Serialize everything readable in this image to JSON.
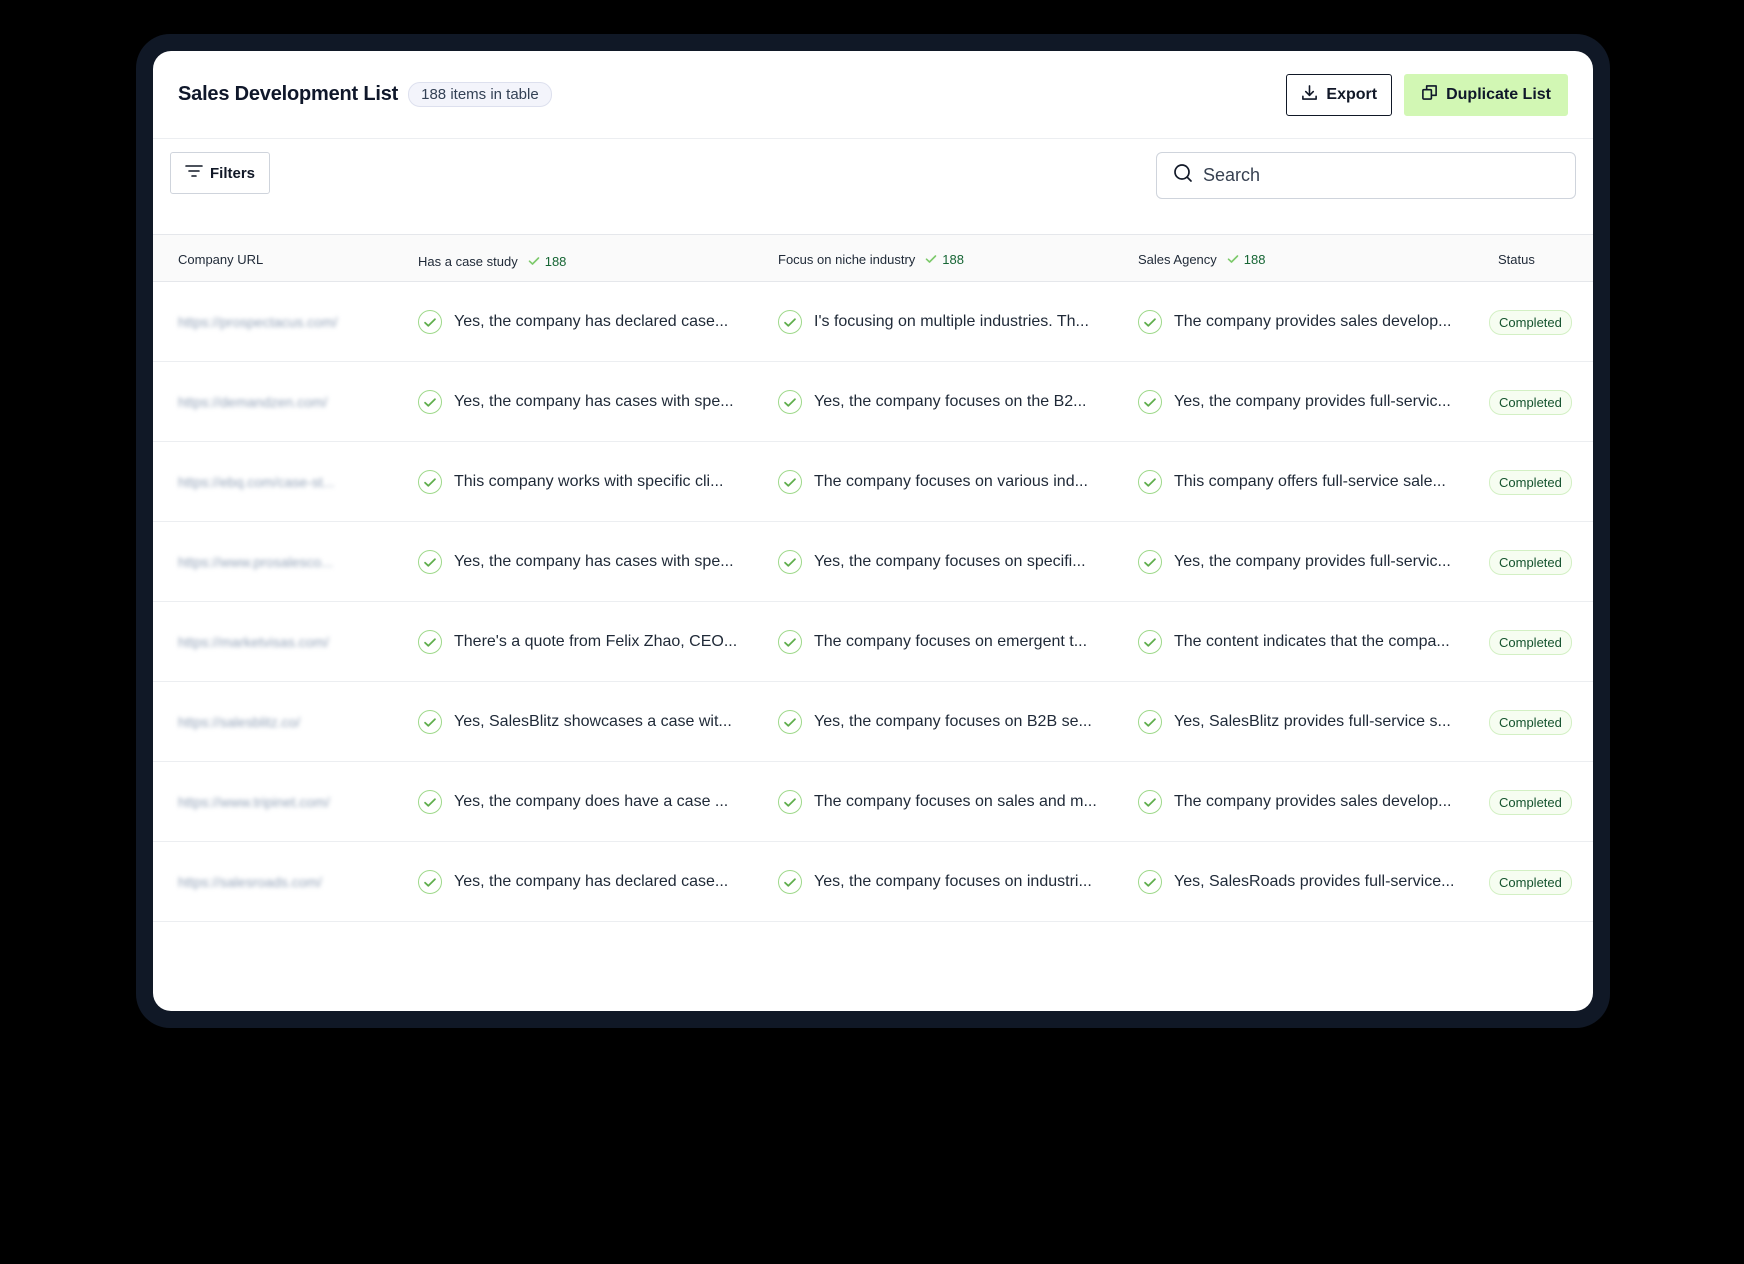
{
  "header": {
    "title": "Sales Development List",
    "badge": "188 items in table",
    "export_label": "Export",
    "duplicate_label": "Duplicate List"
  },
  "toolbar": {
    "filters_label": "Filters",
    "search_placeholder": "Search"
  },
  "columns": {
    "company_url": "Company URL",
    "case_study": "Has a case study",
    "case_study_count": "188",
    "niche": "Focus on niche industry",
    "niche_count": "188",
    "agency": "Sales Agency",
    "agency_count": "188",
    "status": "Status"
  },
  "rows": [
    {
      "url": "https://prospectacus.com/",
      "case_study": "Yes, the company has declared case...",
      "niche": "I's focusing on multiple industries. Th...",
      "agency": "The company provides sales develop...",
      "status": "Completed"
    },
    {
      "url": "https://demandzen.com/",
      "case_study": "Yes, the company has cases with spe...",
      "niche": "Yes, the company focuses on the B2...",
      "agency": "Yes, the company provides full-servic...",
      "status": "Completed"
    },
    {
      "url": "https://ebq.com/case-st...",
      "case_study": "This company works with specific cli...",
      "niche": "The company focuses on various ind...",
      "agency": "This company offers full-service sale...",
      "status": "Completed"
    },
    {
      "url": "https://www.prosalesco...",
      "case_study": "Yes, the company has cases with spe...",
      "niche": "Yes, the company focuses on specifi...",
      "agency": "Yes, the company provides full-servic...",
      "status": "Completed"
    },
    {
      "url": "https://marketvisas.com/",
      "case_study": "There's a quote from Felix Zhao, CEO...",
      "niche": "The company focuses on emergent t...",
      "agency": "The content indicates that the compa...",
      "status": "Completed"
    },
    {
      "url": "https://salesblitz.co/",
      "case_study": "Yes, SalesBlitz showcases a case wit...",
      "niche": "Yes, the company focuses on B2B se...",
      "agency": "Yes, SalesBlitz provides full-service s...",
      "status": "Completed"
    },
    {
      "url": "https://www.tripinet.com/",
      "case_study": "Yes, the company does have a case ...",
      "niche": "The company focuses on sales and m...",
      "agency": "The company provides sales develop...",
      "status": "Completed"
    },
    {
      "url": "https://salesroads.com/",
      "case_study": "Yes, the company has declared case...",
      "niche": "Yes, the company focuses on industri...",
      "agency": "Yes, SalesRoads provides full-service...",
      "status": "Completed"
    }
  ],
  "colors": {
    "accent": "#d2f7b4",
    "check": "#9ed98a",
    "frame": "#101826"
  },
  "icons": {
    "export": "download-icon",
    "duplicate": "copy-icon",
    "filters": "filter-icon",
    "search": "search-icon",
    "check": "check-circle-icon"
  }
}
